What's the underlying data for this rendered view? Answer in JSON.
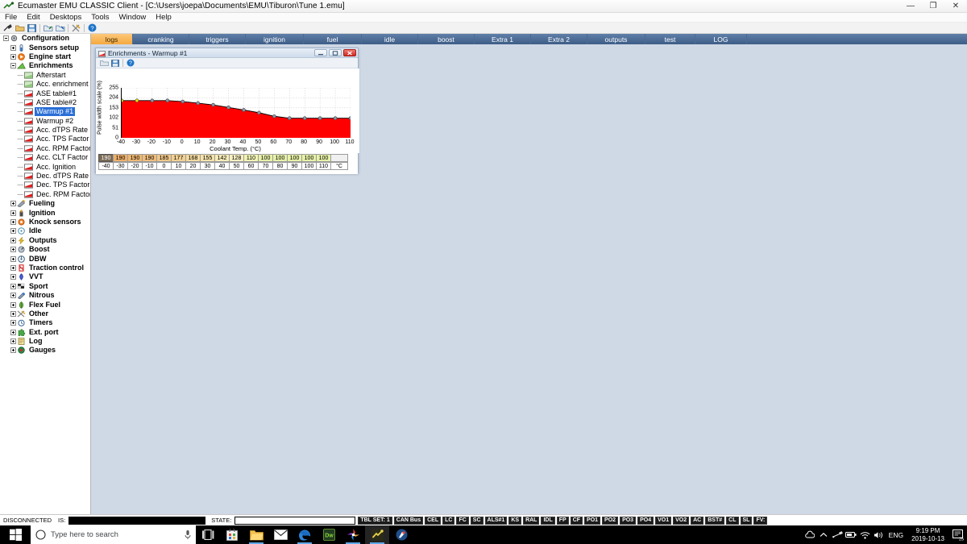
{
  "window": {
    "title": "Ecumaster EMU CLASSIC Client - [C:\\Users\\joepa\\Documents\\EMU\\Tiburon\\Tune 1.emu]",
    "minimize": "—",
    "maximize": "❐",
    "close": "✕"
  },
  "menu": {
    "items": [
      {
        "label": "File"
      },
      {
        "label": "Edit"
      },
      {
        "label": "Desktops"
      },
      {
        "label": "Tools"
      },
      {
        "label": "Window"
      },
      {
        "label": "Help"
      }
    ]
  },
  "toolbar": {
    "buttons": [
      {
        "name": "connect-icon"
      },
      {
        "name": "open-file-icon"
      },
      {
        "name": "save-file-icon"
      },
      {
        "name": "import-icon"
      },
      {
        "name": "export-icon"
      },
      {
        "name": "tools-icon"
      },
      {
        "name": "help-icon"
      }
    ]
  },
  "tree": {
    "items": [
      {
        "label": "Configuration",
        "depth": 0,
        "icon": "gear",
        "bold": true,
        "expander": "minus",
        "selected": false
      },
      {
        "label": "Sensors setup",
        "depth": 1,
        "icon": "sensor",
        "bold": true,
        "expander": "plus",
        "selected": false
      },
      {
        "label": "Engine start",
        "depth": 1,
        "icon": "start",
        "bold": true,
        "expander": "plus",
        "selected": false
      },
      {
        "label": "Enrichments",
        "depth": 1,
        "icon": "enrich",
        "bold": true,
        "expander": "minus",
        "selected": false
      },
      {
        "label": "Afterstart",
        "depth": 2,
        "icon": "table-green",
        "bold": false,
        "expander": "none",
        "selected": false
      },
      {
        "label": "Acc. enrichment",
        "depth": 2,
        "icon": "table-green",
        "bold": false,
        "expander": "none",
        "selected": false
      },
      {
        "label": "ASE table#1",
        "depth": 2,
        "icon": "table-red",
        "bold": false,
        "expander": "none",
        "selected": false
      },
      {
        "label": "ASE table#2",
        "depth": 2,
        "icon": "table-red",
        "bold": false,
        "expander": "none",
        "selected": false
      },
      {
        "label": "Warmup #1",
        "depth": 2,
        "icon": "table-red",
        "bold": false,
        "expander": "none",
        "selected": true
      },
      {
        "label": "Warmup #2",
        "depth": 2,
        "icon": "table-red",
        "bold": false,
        "expander": "none",
        "selected": false
      },
      {
        "label": "Acc. dTPS Rate",
        "depth": 2,
        "icon": "table-red",
        "bold": false,
        "expander": "none",
        "selected": false
      },
      {
        "label": "Acc. TPS Factor",
        "depth": 2,
        "icon": "table-red",
        "bold": false,
        "expander": "none",
        "selected": false
      },
      {
        "label": "Acc. RPM Factor",
        "depth": 2,
        "icon": "table-red",
        "bold": false,
        "expander": "none",
        "selected": false
      },
      {
        "label": "Acc. CLT Factor",
        "depth": 2,
        "icon": "table-red",
        "bold": false,
        "expander": "none",
        "selected": false
      },
      {
        "label": "Acc. Ignition",
        "depth": 2,
        "icon": "table-red",
        "bold": false,
        "expander": "none",
        "selected": false
      },
      {
        "label": "Dec. dTPS Rate",
        "depth": 2,
        "icon": "table-red",
        "bold": false,
        "expander": "none",
        "selected": false
      },
      {
        "label": "Dec. TPS Factor",
        "depth": 2,
        "icon": "table-red",
        "bold": false,
        "expander": "none",
        "selected": false
      },
      {
        "label": "Dec. RPM Factor",
        "depth": 2,
        "icon": "table-red",
        "bold": false,
        "expander": "none",
        "selected": false
      },
      {
        "label": "Fueling",
        "depth": 1,
        "icon": "fueling",
        "bold": true,
        "expander": "plus",
        "selected": false
      },
      {
        "label": "Ignition",
        "depth": 1,
        "icon": "ignition",
        "bold": true,
        "expander": "plus",
        "selected": false
      },
      {
        "label": "Knock sensors",
        "depth": 1,
        "icon": "knock",
        "bold": true,
        "expander": "plus",
        "selected": false
      },
      {
        "label": "Idle",
        "depth": 1,
        "icon": "idle",
        "bold": true,
        "expander": "plus",
        "selected": false
      },
      {
        "label": "Outputs",
        "depth": 1,
        "icon": "outputs",
        "bold": true,
        "expander": "plus",
        "selected": false
      },
      {
        "label": "Boost",
        "depth": 1,
        "icon": "boost",
        "bold": true,
        "expander": "plus",
        "selected": false
      },
      {
        "label": "DBW",
        "depth": 1,
        "icon": "dbw",
        "bold": true,
        "expander": "plus",
        "selected": false
      },
      {
        "label": "Traction control",
        "depth": 1,
        "icon": "traction",
        "bold": true,
        "expander": "plus",
        "selected": false
      },
      {
        "label": "VVT",
        "depth": 1,
        "icon": "vvt",
        "bold": true,
        "expander": "plus",
        "selected": false
      },
      {
        "label": "Sport",
        "depth": 1,
        "icon": "sport",
        "bold": true,
        "expander": "plus",
        "selected": false
      },
      {
        "label": "Nitrous",
        "depth": 1,
        "icon": "nitrous",
        "bold": true,
        "expander": "plus",
        "selected": false
      },
      {
        "label": "Flex Fuel",
        "depth": 1,
        "icon": "flexfuel",
        "bold": true,
        "expander": "plus",
        "selected": false
      },
      {
        "label": "Other",
        "depth": 1,
        "icon": "other",
        "bold": true,
        "expander": "plus",
        "selected": false
      },
      {
        "label": "Timers",
        "depth": 1,
        "icon": "timers",
        "bold": true,
        "expander": "plus",
        "selected": false
      },
      {
        "label": "Ext. port",
        "depth": 1,
        "icon": "extport",
        "bold": true,
        "expander": "plus",
        "selected": false
      },
      {
        "label": "Log",
        "depth": 1,
        "icon": "log",
        "bold": true,
        "expander": "plus",
        "selected": false
      },
      {
        "label": "Gauges",
        "depth": 1,
        "icon": "gauges",
        "bold": true,
        "expander": "plus",
        "selected": false
      }
    ]
  },
  "tabs": {
    "active_index": 0,
    "items": [
      {
        "label": "logs"
      },
      {
        "label": "cranking"
      },
      {
        "label": "triggers"
      },
      {
        "label": "ignition"
      },
      {
        "label": "fuel"
      },
      {
        "label": "idle"
      },
      {
        "label": "boost"
      },
      {
        "label": "Extra 1"
      },
      {
        "label": "Extra 2"
      },
      {
        "label": "outputs"
      },
      {
        "label": "test"
      },
      {
        "label": "LOG"
      }
    ]
  },
  "child_window": {
    "title": "Enrichments - Warmup #1",
    "minimize_label": "–",
    "maximize_label": "□",
    "close_label": "✕",
    "toolbar": [
      {
        "name": "open-icon"
      },
      {
        "name": "save-icon"
      },
      {
        "name": "help-icon"
      }
    ]
  },
  "chart_data": {
    "type": "area",
    "title": "Enrichments - Warmup #1",
    "xlabel": "Coolant Temp. (°C)",
    "ylabel": "Pulse width scale (%)",
    "categories": [
      -40,
      -30,
      -20,
      -10,
      0,
      10,
      20,
      30,
      40,
      50,
      60,
      70,
      80,
      90,
      100,
      110
    ],
    "values": [
      190,
      190,
      190,
      190,
      185,
      177,
      168,
      155,
      142,
      128,
      110,
      100,
      100,
      100,
      100,
      100
    ],
    "xticks": [
      -40,
      -30,
      -20,
      -10,
      0,
      10,
      20,
      30,
      40,
      50,
      60,
      70,
      80,
      90,
      100,
      110
    ],
    "yticks": [
      0,
      51,
      102,
      153,
      204,
      255
    ],
    "ylim": [
      0,
      255
    ],
    "xlim": [
      -40,
      110
    ],
    "grid": true,
    "fill_color": "#ff0000",
    "line_color": "#000000",
    "marker_color": "#8a97a8",
    "selected_marker_color": "#ffe000",
    "selected_indices": [
      0,
      1
    ],
    "unit_label": "°C",
    "selected_cell_index": 0,
    "cell_colors": [
      "#e8a05a",
      "#eeb06a",
      "#eeb873",
      "#efbe7c",
      "#f0c788",
      "#f2d193",
      "#f3da9f",
      "#f5e3ab",
      "#f7ecb8",
      "#f8f0c2",
      "#f2f4b4",
      "#e8f2a8",
      "#e8f2a8",
      "#e8f2a8",
      "#e8f2a8",
      "#e8f2a8"
    ]
  },
  "statusbar": {
    "connection": "DISCONNECTED",
    "is_label": "IS:",
    "is_value": "",
    "state_label": "STATE:",
    "state_value": "",
    "tbl_set": "TBL SET: 1",
    "badges": [
      {
        "label": "CAN Bus"
      },
      {
        "label": "CEL"
      },
      {
        "label": "LC"
      },
      {
        "label": "FC"
      },
      {
        "label": "SC"
      },
      {
        "label": "ALS#1"
      },
      {
        "label": "KS"
      },
      {
        "label": "RAL"
      },
      {
        "label": "IDL"
      },
      {
        "label": "FP"
      },
      {
        "label": "CF"
      },
      {
        "label": "PO1"
      },
      {
        "label": "PO2"
      },
      {
        "label": "PO3"
      },
      {
        "label": "PO4"
      },
      {
        "label": "VO1"
      },
      {
        "label": "VO2"
      },
      {
        "label": "AC"
      },
      {
        "label": "BST#"
      },
      {
        "label": "CL"
      },
      {
        "label": "SL"
      },
      {
        "label": "FV:"
      }
    ]
  },
  "taskbar": {
    "search_placeholder": "Type here to search",
    "apps": [
      {
        "name": "task-view-icon"
      },
      {
        "name": "microsoft-store-icon"
      },
      {
        "name": "file-explorer-icon"
      },
      {
        "name": "mail-icon"
      },
      {
        "name": "edge-icon"
      },
      {
        "name": "dreamweaver-icon"
      },
      {
        "name": "photos-icon"
      },
      {
        "name": "ecumaster-client-icon"
      },
      {
        "name": "paint-icon"
      }
    ],
    "language": "ENG",
    "time": "9:19 PM",
    "date": "2019-10-13",
    "tray": [
      {
        "name": "onedrive-icon"
      },
      {
        "name": "show-hidden-icons-icon"
      },
      {
        "name": "usb-icon"
      },
      {
        "name": "battery-icon"
      },
      {
        "name": "network-icon"
      },
      {
        "name": "volume-icon"
      }
    ],
    "notification_count": "25"
  }
}
